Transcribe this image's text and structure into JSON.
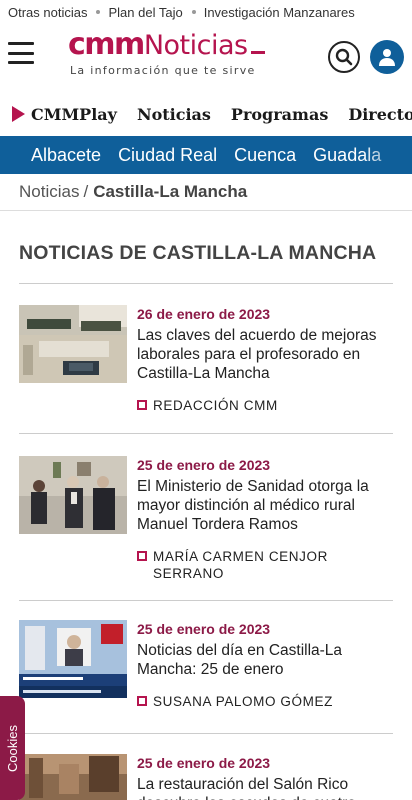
{
  "ticker": [
    "Otras noticias",
    "Plan del Tajo",
    "Investigación Manzanares"
  ],
  "brand": {
    "cmm": "cmm",
    "noticias": "Noticias",
    "tagline": "La información que te sirve"
  },
  "nav": {
    "items": [
      "CMMPlay",
      "Noticias",
      "Programas",
      "Directos"
    ]
  },
  "regions": [
    "Albacete",
    "Ciudad Real",
    "Cuenca",
    "Guadala"
  ],
  "breadcrumb": {
    "root": "Noticias",
    "separator": "/",
    "current": "Castilla-La Mancha"
  },
  "section": {
    "title": "NOTICIAS DE CASTILLA-LA MANCHA"
  },
  "articles": [
    {
      "date": "26 de enero de 2023",
      "headline": "Las claves del acuerdo de mejoras laborales para el profesorado en Castilla-La Mancha",
      "author": "Redacción CMM"
    },
    {
      "date": "25 de enero de 2023",
      "headline": "El Ministerio de Sanidad otorga la mayor distinción al médico rural Manuel Tordera Ramos",
      "author": "María Carmen Cenjor Serrano"
    },
    {
      "date": "25 de enero de 2023",
      "headline": "Noticias del día en Castilla-La Mancha: 25 de enero",
      "author": "Susana Palomo Gómez"
    },
    {
      "date": "25 de enero de 2023",
      "headline": "La restauración del Salón Rico descubre los escudos de cuatro",
      "author": ""
    }
  ],
  "cookies": {
    "label": "Cookies"
  },
  "colors": {
    "brand": "#b5144e",
    "date": "#8c1a47",
    "regions_bg": "#0f5f9a"
  }
}
